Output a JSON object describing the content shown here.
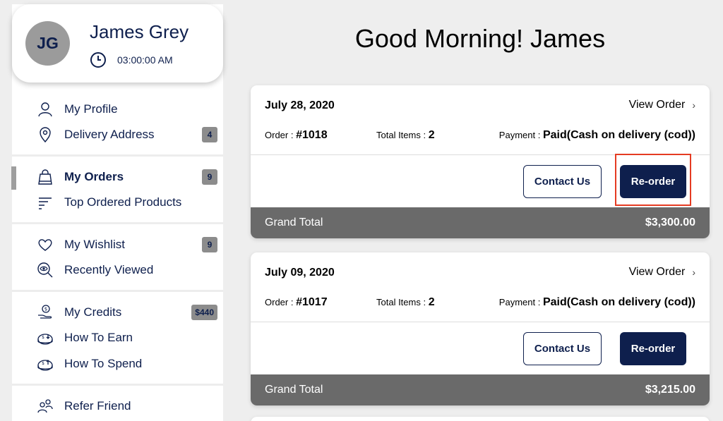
{
  "user": {
    "initials": "JG",
    "name": "James Grey",
    "time": "03:00:00 AM"
  },
  "greeting": "Good Morning! James",
  "sidebar": {
    "items": [
      {
        "label": "My Profile",
        "icon": "user-icon",
        "badge": ""
      },
      {
        "label": "Delivery Address",
        "icon": "location-pin-icon",
        "badge": "4"
      },
      {
        "label": "My Orders",
        "icon": "shopping-bag-icon",
        "badge": "9",
        "active": true
      },
      {
        "label": "Top Ordered Products",
        "icon": "sort-lines-icon",
        "badge": ""
      },
      {
        "label": "My Wishlist",
        "icon": "heart-icon",
        "badge": "9"
      },
      {
        "label": "Recently Viewed",
        "icon": "eye-search-icon",
        "badge": ""
      },
      {
        "label": "My Credits",
        "icon": "dollar-hand-icon",
        "badge": "$440"
      },
      {
        "label": "How To Earn",
        "icon": "earn-icon",
        "badge": ""
      },
      {
        "label": "How To Spend",
        "icon": "spend-icon",
        "badge": ""
      },
      {
        "label": "Refer Friend",
        "icon": "refer-friend-icon",
        "badge": ""
      }
    ]
  },
  "orders": [
    {
      "date": "July 28, 2020",
      "view_label": "View Order",
      "order_label": "Order :",
      "order_no": "#1018",
      "items_label": "Total Items :",
      "items": "2",
      "payment_label": "Payment :",
      "payment": "Paid(Cash on delivery (cod))",
      "contact_label": "Contact Us",
      "reorder_label": "Re-order",
      "total_label": "Grand Total",
      "total": "$3,300.00"
    },
    {
      "date": "July 09, 2020",
      "view_label": "View Order",
      "order_label": "Order :",
      "order_no": "#1017",
      "items_label": "Total Items :",
      "items": "2",
      "payment_label": "Payment :",
      "payment": "Paid(Cash on delivery (cod))",
      "contact_label": "Contact Us",
      "reorder_label": "Re-order",
      "total_label": "Grand Total",
      "total": "$3,215.00"
    }
  ],
  "colors": {
    "navy": "#0e1f4d",
    "total_bar": "#6a6a6a",
    "highlight": "#e53b22",
    "badge": "#8c8c8c"
  }
}
